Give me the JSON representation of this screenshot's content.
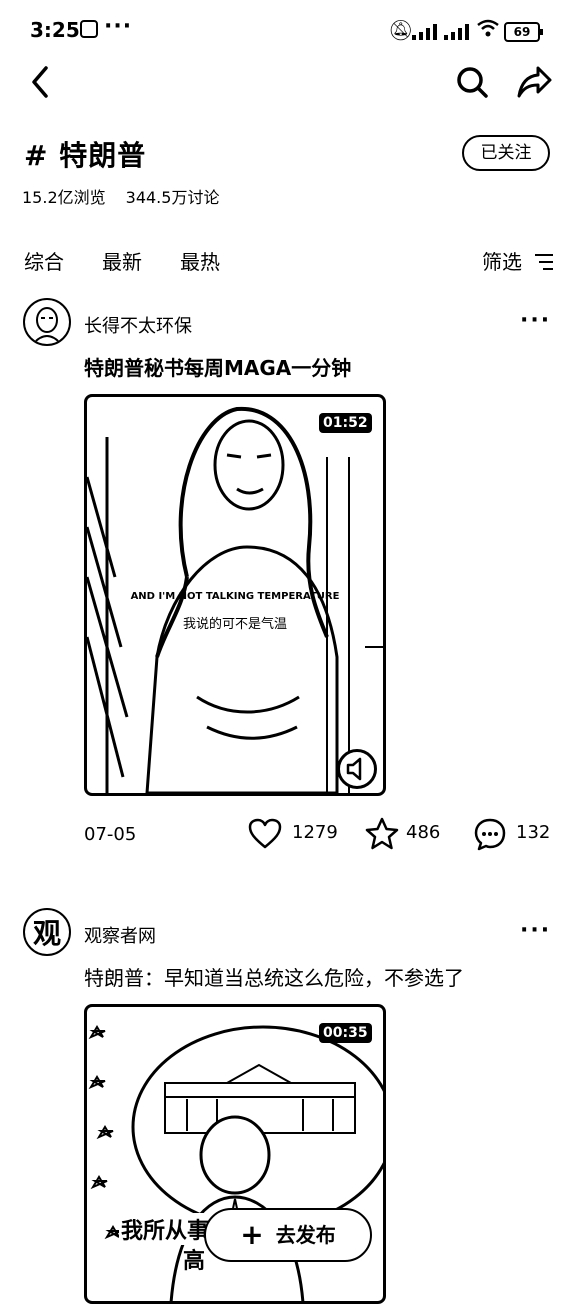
{
  "status_bar": {
    "time": "3:25",
    "battery": "69"
  },
  "topic": {
    "title": "# 特朗普",
    "follow_label": "已关注",
    "views": "15.2亿浏览",
    "discussions": "344.5万讨论"
  },
  "tabs": [
    {
      "label": "综合"
    },
    {
      "label": "最新"
    },
    {
      "label": "最热"
    }
  ],
  "filter_label": "筛选",
  "posts": [
    {
      "author": "长得不太环保",
      "title": "特朗普秘书每周MAGA一分钟",
      "duration": "01:52",
      "subtitle_en": "AND I'M NOT TALKING TEMPERATURE",
      "subtitle_cn": "我说的可不是气温",
      "date": "07-05",
      "likes": "1279",
      "favorites": "486",
      "comments": "132"
    },
    {
      "author": "观察者网",
      "title": "特朗普：早知道当总统这么危险，不参选了",
      "duration": "00:35",
      "caption_line1": "我所从事",
      "caption_line2": "高"
    }
  ],
  "publish_label": "去发布"
}
